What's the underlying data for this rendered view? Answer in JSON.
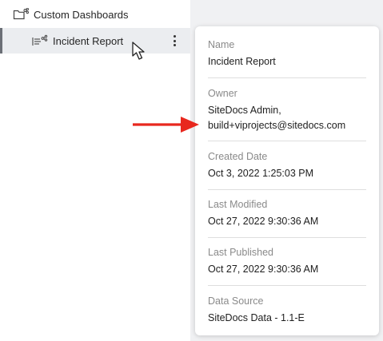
{
  "tree": {
    "folder_label": "Custom Dashboards",
    "report_label": "Incident Report"
  },
  "details": {
    "fields": [
      {
        "label": "Name",
        "value": "Incident Report"
      },
      {
        "label": "Owner",
        "value": "SiteDocs Admin,",
        "value2": "build+viprojects@sitedocs.com"
      },
      {
        "label": "Created Date",
        "value": "Oct 3, 2022 1:25:03 PM"
      },
      {
        "label": "Last Modified",
        "value": "Oct 27, 2022 9:30:36 AM"
      },
      {
        "label": "Last Published",
        "value": "Oct 27, 2022 9:30:36 AM"
      },
      {
        "label": "Data Source",
        "value": "SiteDocs Data - 1.1-E"
      }
    ]
  },
  "colors": {
    "annotation_arrow": "#e8281e",
    "selected_row_bg": "#ebedf0",
    "panel_bg": "#f0f1f3"
  },
  "icons": [
    "folder-share-icon",
    "report-list-icon",
    "more-vertical-icon",
    "mouse-pointer-icon",
    "red-arrow-annotation"
  ]
}
